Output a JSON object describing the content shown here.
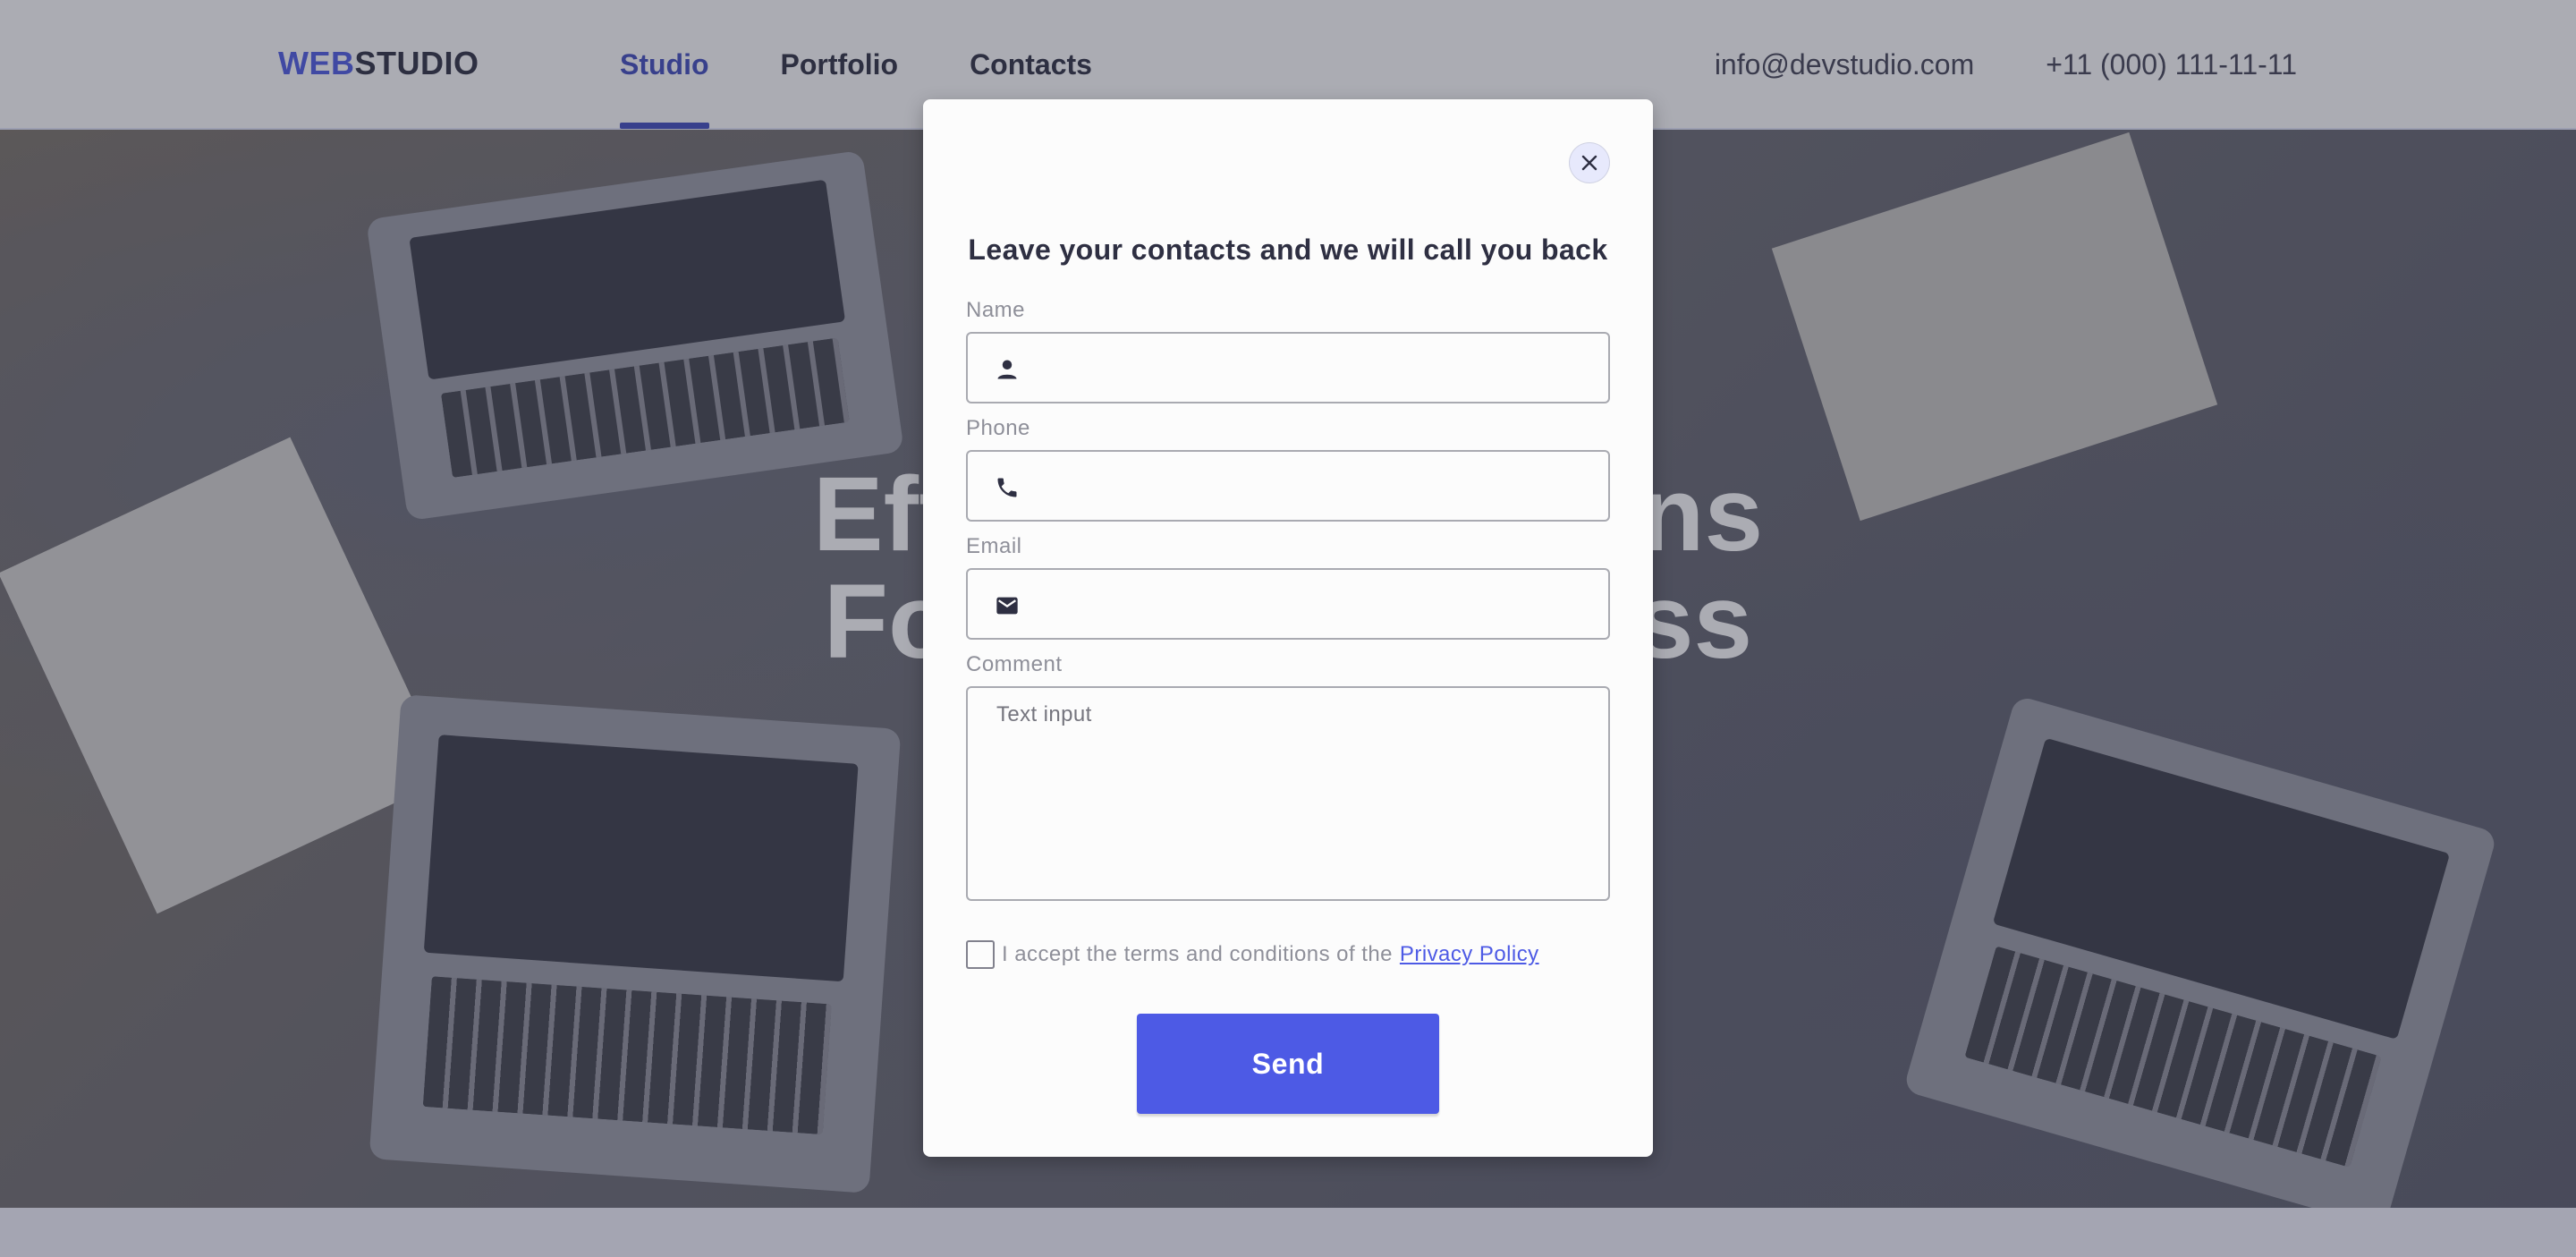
{
  "header": {
    "logo_accent": "WEB",
    "logo_rest": "STUDIO",
    "nav": [
      {
        "label": "Studio",
        "active": true
      },
      {
        "label": "Portfolio",
        "active": false
      },
      {
        "label": "Contacts",
        "active": false
      }
    ],
    "email": "info@devstudio.com",
    "phone": "+11 (000) 111-11-11"
  },
  "hero": {
    "title_line1": "Effective Solutions",
    "title_line2": "For Your Business"
  },
  "modal": {
    "title": "Leave your contacts and we will call you back",
    "fields": {
      "name_label": "Name",
      "phone_label": "Phone",
      "email_label": "Email",
      "comment_label": "Comment",
      "comment_placeholder": "Text input"
    },
    "icons": {
      "name": "person-icon",
      "phone": "phone-icon",
      "email": "mail-icon",
      "close": "close-icon"
    },
    "consent_text": "I accept the terms and conditions of the",
    "policy_link": "Privacy Policy",
    "send_label": "Send"
  },
  "colors": {
    "accent": "#4d5ae5",
    "active_nav": "#404bbf",
    "text_dark": "#2e2f42",
    "backdrop": "rgba(46,47,66,0.4)"
  }
}
